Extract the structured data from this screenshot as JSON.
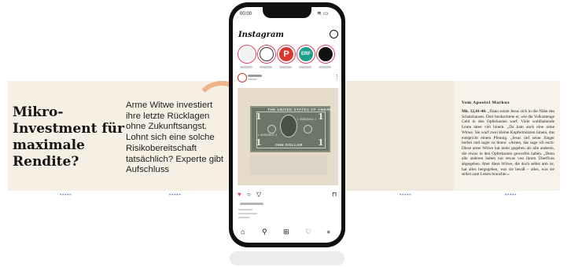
{
  "carousel": {
    "headline": "Mikro-Investment für maximale Rendite?",
    "body": "Arme Witwe investiert ihre letzte Rücklagen ohne Zukunftsangst. Lohnt sich eine solche Risikobereitschaft tatsächlich? Experte gibt Aufschluss",
    "page_indicator": "•••••",
    "bible_title": "Vom Apostel Markus",
    "bible_ref": "Mk. 12,41-44:",
    "bible_text": "„Dann setzte Jesus sich in die Nähe des Schatzhauses. Dort beobachtete er, wie die Volksmenge Geld in den Opferkasten warf. Viele wohlhabende Leute taten viel hinein. „Da kam auch eine arme Witwe. Sie warf zwei kleine Kupfermünzen hinein, das entspricht einem Pfennig. „Jesus rief seine Jünger herbei und sagte zu ihnen: »Amen, das sage ich euch: Diese arme Witwe hat mehr gegeben als alle anderen, die etwas in den Opferkasten geworfen haben. „Denn alle anderen haben nur etwas von ihrem Überfluss abgegeben. Aber diese Witwe, die doch selbst arm ist, hat alles hergegeben, was sie besaß – alles, was sie selbst zum Leben brauchte.«"
  },
  "phone": {
    "status_time": "00:00",
    "status_icons": "≋ ▭",
    "app_title": "Instagram",
    "stories": [
      {
        "label": "",
        "color": "#f2f2f2",
        "icon": "story-avatar"
      },
      {
        "label": "",
        "color": "#ffffff",
        "icon": "wheel-logo"
      },
      {
        "label": "",
        "color": "#d9382c",
        "icon": "p-logo"
      },
      {
        "label": "",
        "color": "#1f9e8c",
        "icon": "erf-logo"
      },
      {
        "label": "",
        "color": "#111111",
        "icon": "book-logo"
      }
    ],
    "story_letters": {
      "p": "P",
      "erf": "ERF"
    },
    "post": {
      "avatar_text": "RS",
      "more": "⋮",
      "bill_top": "THE UNITED STATES OF AMERICA",
      "bill_serial": "L 89823401 J",
      "bill_value": "1",
      "bill_bottom": "ONE DOLLAR"
    },
    "actions": {
      "like": "♥",
      "comment": "○",
      "share": "▽",
      "save": "⊓"
    },
    "nav": {
      "home": "⌂",
      "search": "⚲",
      "add": "⊞",
      "activity": "♡",
      "profile": "●"
    }
  },
  "colors": {
    "accent_red": "#e4405f",
    "bill_green": "#6e7566",
    "indicator_blue": "#4b74c4"
  }
}
